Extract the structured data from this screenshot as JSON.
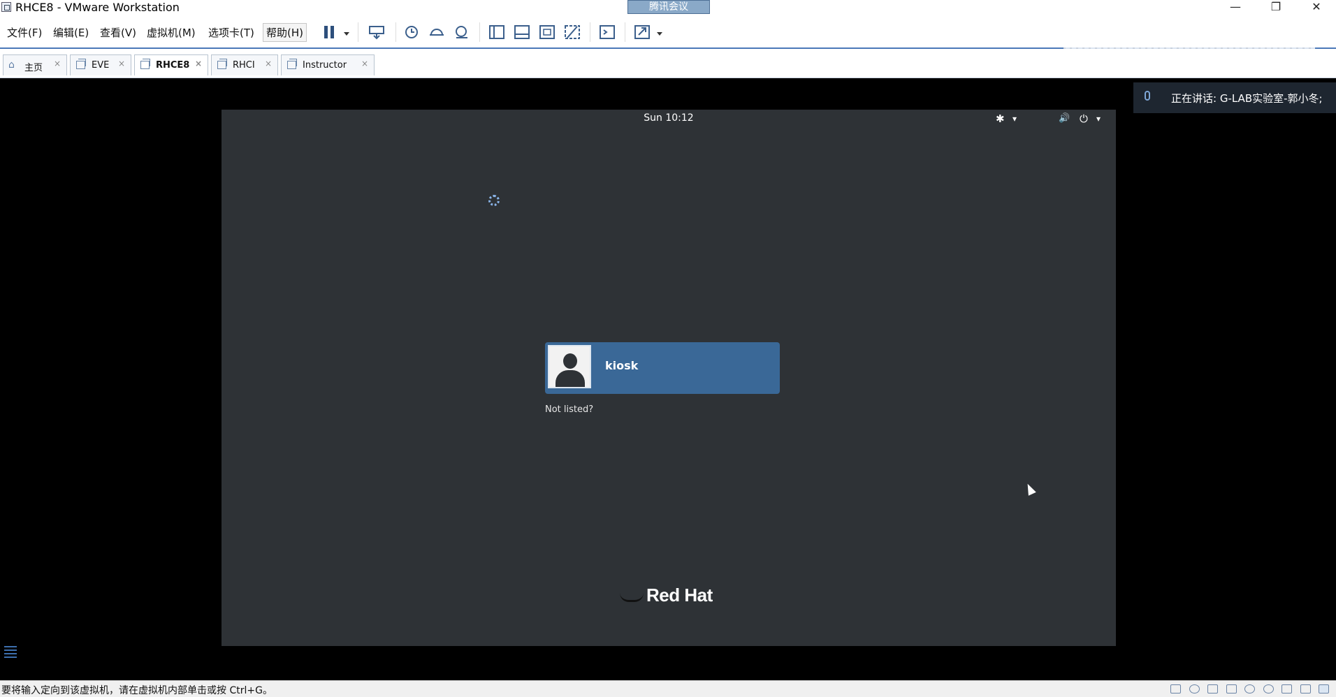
{
  "window": {
    "title": "RHCE8 - VMware Workstation",
    "meeting_tag": "腾讯会议",
    "minimize": "—",
    "restore": "❐",
    "close": "✕"
  },
  "menu": {
    "file": "文件(F)",
    "edit": "编辑(E)",
    "view": "查看(V)",
    "vm": "虚拟机(M)",
    "tabs": "选项卡(T)",
    "help": "帮助(H)"
  },
  "tabs": [
    {
      "label": "主页"
    },
    {
      "label": "EVE"
    },
    {
      "label": "RHCE8"
    },
    {
      "label": "RHCI"
    },
    {
      "label": "Instructor"
    }
  ],
  "tab_close": "×",
  "vm": {
    "clock": "Sun 10:12",
    "accessibility_icon": "✱",
    "volume_icon": "🔊",
    "power_icon": "⏻",
    "dropdown_icon": "▾",
    "user_name": "kiosk",
    "not_listed": "Not listed?",
    "brand": "Red Hat"
  },
  "meeting": {
    "speaking": "正在讲话: G-LAB实验室-郭小冬;"
  },
  "status": {
    "message": "要将输入定向到该虚拟机，请在虚拟机内部单击或按 Ctrl+G。"
  },
  "colors": {
    "vm_background": "#2e3236",
    "user_card": "#3a6897",
    "toolbar_accent": "#4a78b8"
  }
}
